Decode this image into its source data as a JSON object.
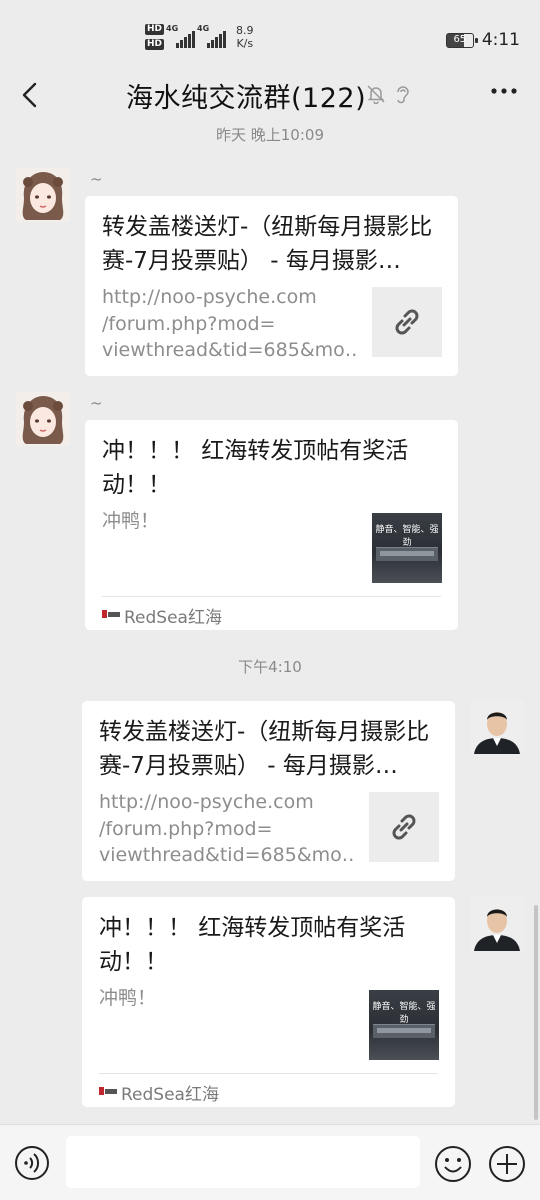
{
  "status_bar": {
    "hd1": "HD",
    "hd2": "HD",
    "net1": "4G",
    "net2": "4G",
    "speed_value": "8.9",
    "speed_unit": "K/s",
    "battery": "65",
    "time": "4:11"
  },
  "header": {
    "title": "海水纯交流群(122)",
    "icons": [
      "back-chevron-icon",
      "mute-bell-icon",
      "ear-icon",
      "more-dots-icon"
    ]
  },
  "messages": [
    {
      "type": "timestamp",
      "text": "昨天 晚上10:09"
    },
    {
      "type": "card",
      "side": "left",
      "sender": "~",
      "title": "转发盖楼送灯-（纽斯每月摄影比赛-7月投票贴） - 每月摄影…",
      "desc": "http://noo-psyche.com/forum.php?mod=viewthread&tid=685&mo…",
      "desc_lines": [
        "http://noo-psyche.com",
        "/forum.php?mod=",
        "viewthread&tid=685&mo…"
      ],
      "thumb": "link-icon"
    },
    {
      "type": "card",
      "side": "left",
      "sender": "~",
      "title": "冲！！！ 红海转发顶帖有奖活动！！",
      "desc": "冲鸭！",
      "thumb_text": "静音、智能、强劲",
      "source": "RedSea红海"
    },
    {
      "type": "timestamp",
      "text": "下午4:10"
    },
    {
      "type": "card",
      "side": "right",
      "title": "转发盖楼送灯-（纽斯每月摄影比赛-7月投票贴） - 每月摄影…",
      "desc": "http://noo-psyche.com/forum.php?mod=viewthread&tid=685&mo…",
      "desc_lines": [
        "http://noo-psyche.com",
        "/forum.php?mod=",
        "viewthread&tid=685&mo…"
      ],
      "thumb": "link-icon"
    },
    {
      "type": "card",
      "side": "right",
      "title": "冲！！！ 红海转发顶帖有奖活动！！",
      "desc": "冲鸭！",
      "thumb_text": "静音、智能、强劲",
      "source": "RedSea红海"
    }
  ],
  "input_bar": {
    "value": "",
    "icons": [
      "voice-icon",
      "emoji-icon",
      "plus-icon"
    ]
  },
  "colors": {
    "background": "#ececec",
    "bubble": "#ffffff",
    "muted_text": "#8d8d8d"
  }
}
